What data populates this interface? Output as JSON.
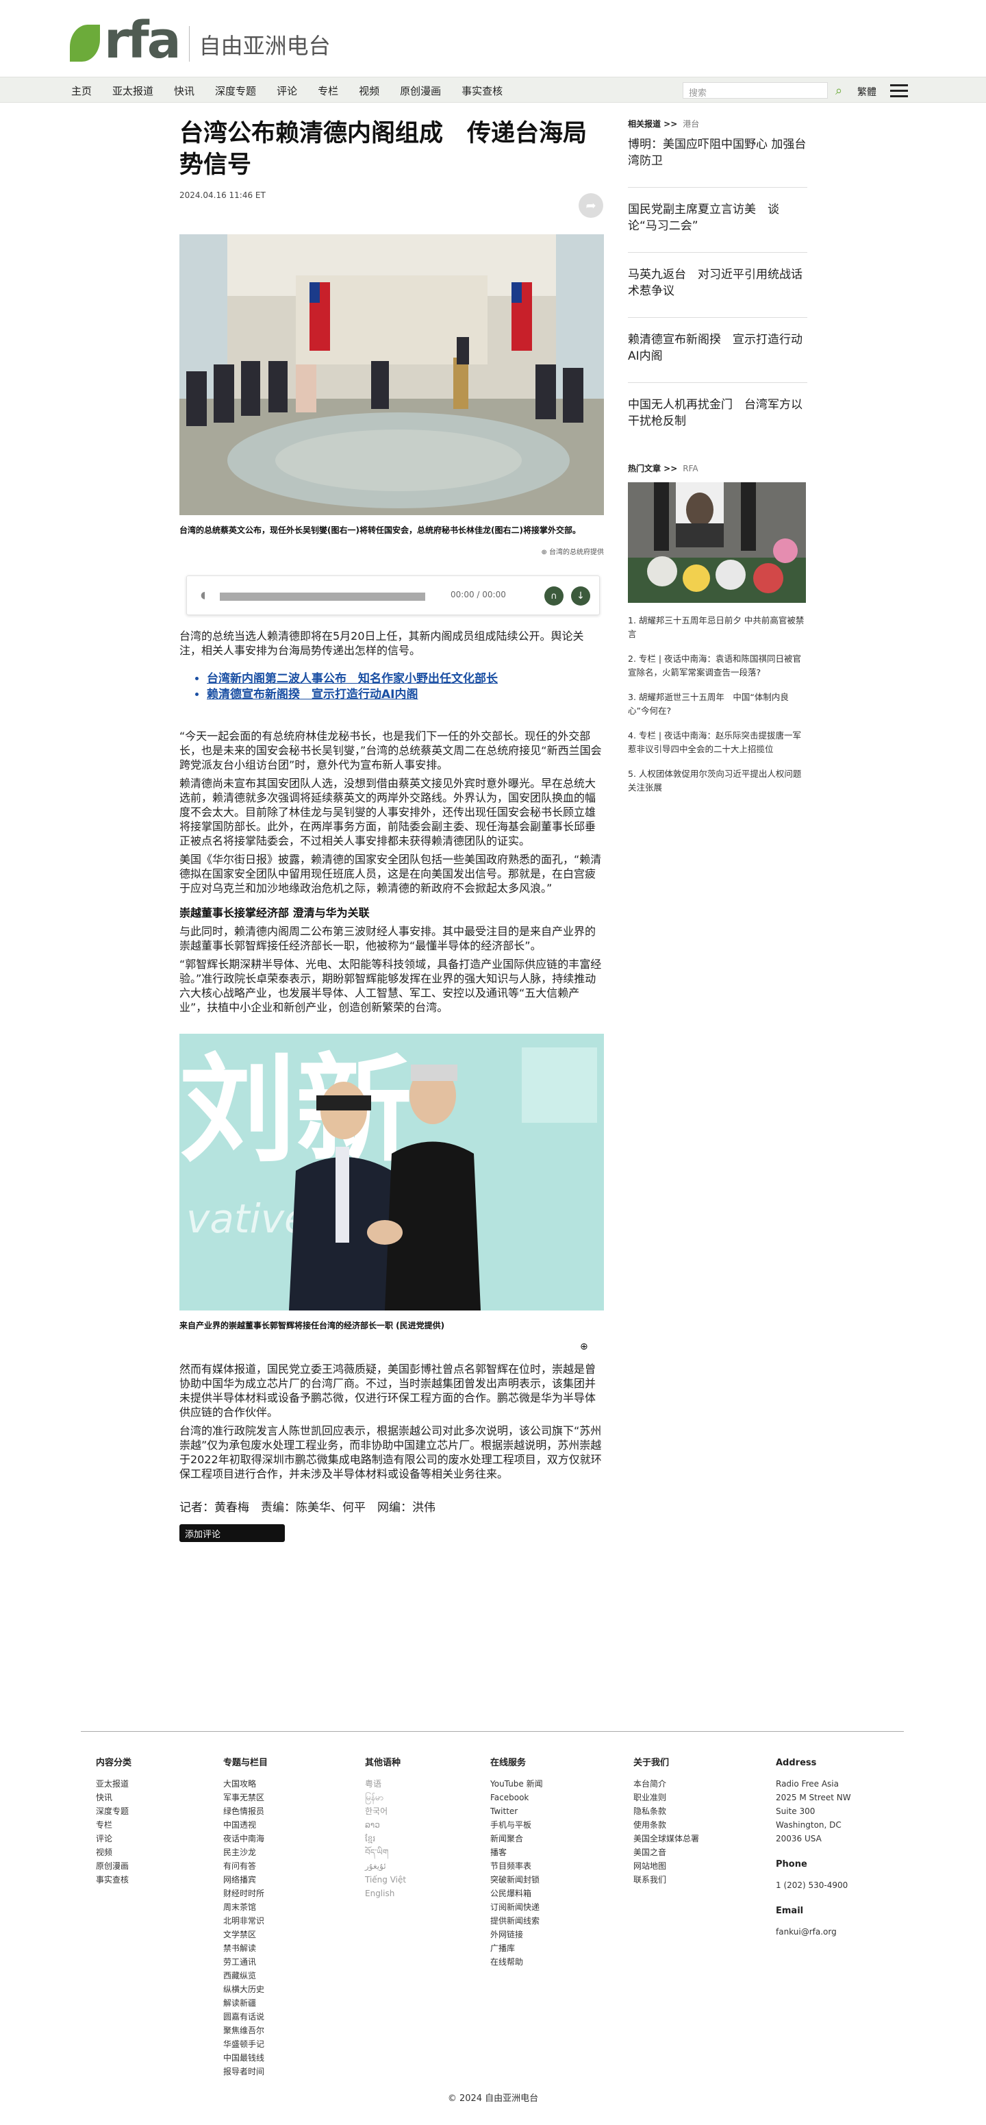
{
  "brand": {
    "name_cn": "自由亚洲电台",
    "logo_text": "rfa"
  },
  "nav": {
    "items": [
      "主页",
      "亚太报道",
      "快讯",
      "深度专题",
      "评论",
      "专栏",
      "视频",
      "原创漫画",
      "事实查核"
    ],
    "search_placeholder": "搜索",
    "lang": "繁體"
  },
  "article": {
    "title": "台湾公布赖清德内阁组成　传递台海局势信号",
    "date": "2024.04.16 11:46 ET",
    "caption1": "台湾的总统蔡英文公布，现任外长吴钊燮(图右一)将转任国安会，总统府秘书长林佳龙(图右二)将接掌外交部。",
    "credit1": "台湾的总统府提供",
    "audio_time": "00:00 / 00:00",
    "intro": "台湾的总统当选人赖清德即将在5月20日上任，其新内阁成员组成陆续公开。舆论关注，相关人事安排为台海局势传递出怎样的信号。",
    "related": [
      "台湾新内阁第二波人事公布　知名作家小野出任文化部长",
      "赖清德宣布新阁揆　宣示打造行动AI内阁"
    ],
    "paragraphs": [
      "“今天一起会面的有总统府林佳龙秘书长，也是我们下一任的外交部长。现任的外交部长，也是未来的国安会秘书长吴钊燮，”台湾的总统蔡英文周二在总统府接见“新西兰国会跨党派友台小组访台团”时，意外代为宣布新人事安排。",
      "赖清德尚未宣布其国安团队人选，没想到借由蔡英文接见外宾时意外曝光。早在总统大选前，赖清德就多次强调将延续蔡英文的两岸外交路线。外界认为，国安团队换血的幅度不会太大。目前除了林佳龙与吴钊燮的人事安排外，还传出现任国安会秘书长顾立雄将接掌国防部长。此外，在两岸事务方面，前陆委会副主委、现任海基会副董事长邱垂正被点名将接掌陆委会，不过相关人事安排都未获得赖清德团队的证实。",
      "美国《华尔街日报》披露，赖清德的国家安全团队包括一些美国政府熟悉的面孔，“赖清德拟在国家安全团队中留用现任班底人员，这是在向美国发出信号。那就是，在白宫疲于应对乌克兰和加沙地缘政治危机之际，赖清德的新政府不会掀起太多风浪。”"
    ],
    "subhead": "崇越董事长接掌经济部 澄清与华为关联",
    "paragraphs2": [
      "与此同时，赖清德内阁周二公布第三波财经人事安排。其中最受注目的是来自产业界的崇越董事长郭智辉接任经济部长一职，他被称为“最懂半导体的经济部长”。",
      "“郭智辉长期深耕半导体、光电、太阳能等科技领域，具备打造产业国际供应链的丰富经验。”准行政院长卓荣泰表示，期盼郭智辉能够发挥在业界的强大知识与人脉，持续推动六大核心战略产业，也发展半导体、人工智慧、军工、安控以及通讯等“五大信赖产业”，扶植中小企业和新创产业，创造创新繁荣的台湾。"
    ],
    "caption2": "来自产业界的崇越董事长郭智辉将接任台湾的经济部长一职 (民进党提供)",
    "paragraphs3": [
      "然而有媒体报道，国民党立委王鸿薇质疑，美国彭博社曾点名郭智辉在位时，崇越是曾协助中国华为成立芯片厂的台湾厂商。不过，当时崇越集团曾发出声明表示，该集团并未提供半导体材料或设备予鹏芯微，仅进行环保工程方面的合作。鹏芯微是华为半导体供应链的合作伙伴。",
      "台湾的准行政院发言人陈世凯回应表示，根据崇越公司对此多次说明，该公司旗下“苏州崇越”仅为承包废水处理工程业务，而非协助中国建立芯片厂。根据崇越说明，苏州崇越于2022年初取得深圳市鹏芯微集成电路制造有限公司的废水处理工程项目，双方仅就环保工程项目进行合作，并未涉及半导体材料或设备等相关业务往来。"
    ],
    "author": "记者：黄春梅　责编：陈美华、何平　网编：洪伟",
    "comment_btn": "添加评论"
  },
  "sidebar": {
    "related_hdr": "相关报道 >>",
    "related_tag": "港台",
    "related": [
      "博明：美国应吓阻中国野心 加强台湾防卫",
      "国民党副主席夏立言访美　谈论“马习二会”",
      "马英九返台　对习近平引用统战话术惹争议",
      "赖清德宣布新阁揆　宣示打造行动AI内阁",
      "中国无人机再扰金门　台湾军方以干扰枪反制"
    ],
    "hot_hdr": "热门文章 >>",
    "hot_tag": "RFA",
    "hot": [
      "1. 胡耀邦三十五周年忌日前夕 中共前高官被禁言",
      "2. 专栏 | 夜话中南海：袁语和陈国祺同日被官宣除名，火箭军常案调查告一段落?",
      "3. 胡耀邦逝世三十五周年　中国“体制内良心”今何在?",
      "4. 专栏 | 夜话中南海：赵乐际突击提拔唐一军惹非议引导四中全会的二十大上招揽位",
      "5. 人权团体敦促用尔茨向习近平提出人权问题　关注张展"
    ]
  },
  "footer": {
    "col1_hdr": "内容分类",
    "col1": [
      "亚太报道",
      "快讯",
      "深度专题",
      "专栏",
      "评论",
      "视频",
      "原创漫画",
      "事实查核"
    ],
    "col2_hdr": "专题与栏目",
    "col2": [
      "大国攻略",
      "军事无禁区",
      "绿色情报员",
      "中国透视",
      "夜话中南海",
      "民主沙龙",
      "有问有答",
      "网络播宾",
      "财经时时所",
      "周末茶馆",
      "北明非常识",
      "文学禁区",
      "禁书解读",
      "劳工通讯",
      "西藏纵览",
      "纵横大历史",
      "解读新疆",
      "圆嘉有话说",
      "聚焦维吾尔",
      "华盛顿手记",
      "中国最钱线",
      "报导者时间"
    ],
    "col3_hdr": "其他语种",
    "col3": [
      "粤语",
      "မြန်မာ",
      "한국어",
      "ລາວ",
      "ខ្មែរ",
      "བོད་ཡིག",
      "ئۇيغۇر",
      "Tiếng Việt",
      "English"
    ],
    "col4_hdr": "在线服务",
    "col4": [
      "YouTube 新闻",
      "Facebook",
      "Twitter",
      "手机与平板",
      "新闻聚合",
      "播客",
      "节目频率表",
      "突破新闻封锁",
      "公民爆料箱",
      "订阅新闻快递",
      "提供新闻线索",
      "外网链接",
      "广播库",
      "在线帮助"
    ],
    "col5_hdr": "关于我们",
    "col5": [
      "本台简介",
      "职业准则",
      "隐私条款",
      "使用条款",
      "美国全球媒体总署",
      "美国之音",
      "网站地图",
      "联系我们"
    ],
    "addr_hdr": "Address",
    "addr": [
      "Radio Free Asia",
      "2025 M Street NW",
      "Suite 300",
      "Washington, DC",
      "20036 USA"
    ],
    "phone_hdr": "Phone",
    "phone": "1 (202) 530-4900",
    "email_hdr": "Email",
    "email": "fankui@rfa.org",
    "copyright": "© 2024 自由亚洲电台"
  }
}
